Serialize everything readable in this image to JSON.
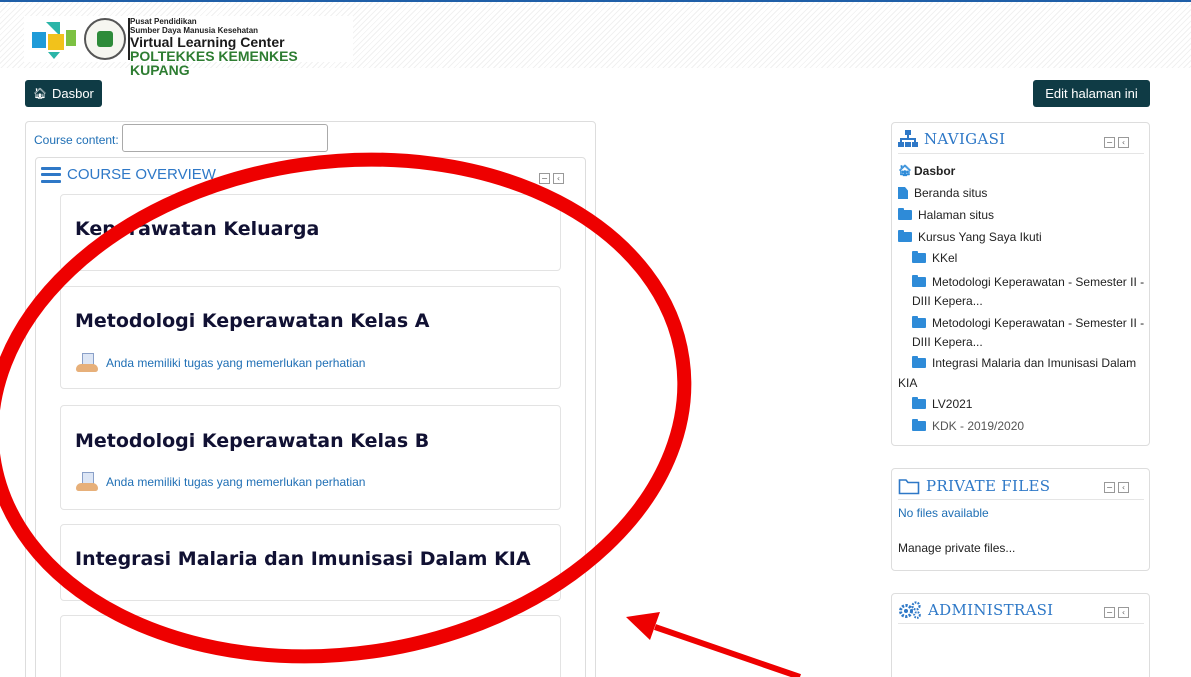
{
  "header": {
    "logo_line1": "Pusat Pendidikan",
    "logo_line2": "Sumber Daya Manusia Kesehatan",
    "logo_line3": "Virtual Learning Center",
    "logo_line4": "POLTEKKES KEMENKES KUPANG"
  },
  "toolbar": {
    "dashboard_label": "Dasbor",
    "edit_label": "Edit halaman ini"
  },
  "course_content": {
    "label": "Course content:",
    "input_value": ""
  },
  "overview": {
    "title": "COURSE OVERVIEW",
    "courses": [
      {
        "title": "Keperawatan Keluarga",
        "note": ""
      },
      {
        "title": "Metodologi Keperawatan Kelas A",
        "note": "Anda memiliki tugas yang memerlukan perhatian"
      },
      {
        "title": "Metodologi Keperawatan Kelas B",
        "note": "Anda memiliki tugas yang memerlukan perhatian"
      },
      {
        "title": "Integrasi Malaria dan Imunisasi Dalam KIA",
        "note": ""
      }
    ]
  },
  "navigation": {
    "title": "NAVIGASI",
    "dashboard": "Dasbor",
    "site_home": "Beranda situs",
    "site_pages": "Halaman situs",
    "my_courses": "Kursus Yang Saya Ikuti",
    "courses": [
      {
        "line1": "KKel",
        "line2": ""
      },
      {
        "line1": "Metodologi Keperawatan - Semester II -",
        "line2": "DIII Kepera..."
      },
      {
        "line1": "Metodologi Keperawatan - Semester II -",
        "line2": "DIII Kepera..."
      },
      {
        "line1": "Integrasi Malaria dan Imunisasi Dalam",
        "line2": "KIA"
      },
      {
        "line1": "LV2021",
        "line2": ""
      },
      {
        "line1": "KDK - 2019/2020",
        "line2": ""
      }
    ]
  },
  "private_files": {
    "title": "PRIVATE FILES",
    "empty_text": "No files available",
    "manage_link": "Manage private files..."
  },
  "administration": {
    "title": "ADMINISTRASI"
  },
  "colors": {
    "accent": "#2e78c7",
    "button_bg": "#0f3b45",
    "annotation": "#ee0000"
  }
}
